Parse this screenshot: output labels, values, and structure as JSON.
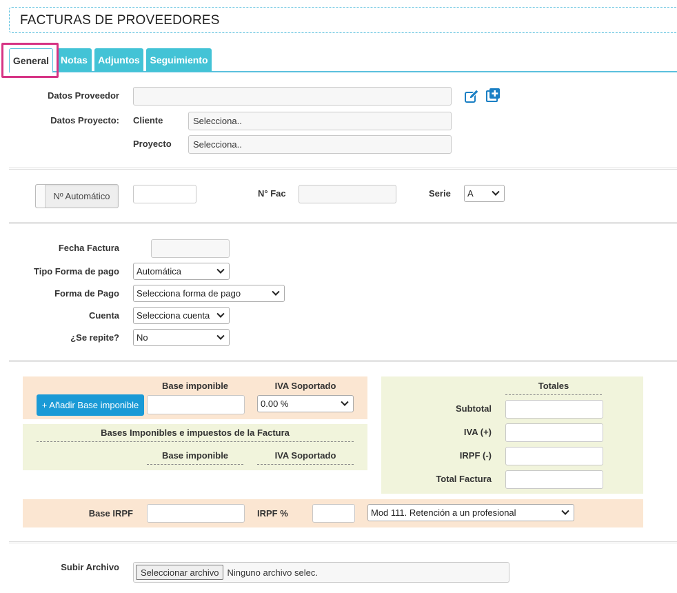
{
  "page": {
    "title": "FACTURAS DE PROVEEDORES"
  },
  "tabs": [
    {
      "label": "General",
      "active": true
    },
    {
      "label": "Notas",
      "active": false
    },
    {
      "label": "Adjuntos",
      "active": false
    },
    {
      "label": "Seguimiento",
      "active": false
    }
  ],
  "proveedor": {
    "label": "Datos Proveedor",
    "value": "",
    "edit_icon": "edit-icon",
    "add_icon": "plus-square-icon"
  },
  "proyecto": {
    "label": "Datos Proyecto:",
    "cliente_label": "Cliente",
    "cliente_value": "Selecciona..",
    "proyecto_label": "Proyecto",
    "proyecto_value": "Selecciona.."
  },
  "numeracion": {
    "toggle_label": "Nº Automático",
    "auto_value": "",
    "nfac_label": "N° Fac",
    "nfac_value": "",
    "serie_label": "Serie",
    "serie_value": "A"
  },
  "pago": {
    "fecha_label": "Fecha Factura",
    "fecha_value": "",
    "tipo_label": "Tipo Forma de pago",
    "tipo_value": "Automática",
    "forma_label": "Forma de Pago",
    "forma_value": "Selecciona forma de pago",
    "cuenta_label": "Cuenta",
    "cuenta_value": "Selecciona cuenta",
    "repite_label": "¿Se repite?",
    "repite_value": "No"
  },
  "bases": {
    "col_base": "Base imponible",
    "col_iva": "IVA Soportado",
    "add_button": "+ Añadir Base imponible",
    "base_value": "",
    "iva_value": "0.00 %",
    "list_title": "Bases Imponibles e impuestos de la Factura",
    "list_col_base": "Base imponible",
    "list_col_iva": "IVA Soportado"
  },
  "totales": {
    "title": "Totales",
    "subtotal_label": "Subtotal",
    "iva_label": "IVA (+)",
    "irpf_label": "IRPF (-)",
    "total_label": "Total Factura",
    "subtotal_value": "",
    "iva_value": "",
    "irpf_value": "",
    "total_value": ""
  },
  "irpf": {
    "base_label": "Base IRPF",
    "base_value": "",
    "pct_label": "IRPF %",
    "pct_value": "",
    "modelo_value": "Mod 111. Retención a un profesional"
  },
  "archivo": {
    "label": "Subir Archivo",
    "button": "Seleccionar archivo",
    "status": "Ninguno archivo selec."
  },
  "colors": {
    "accent": "#5bc0de",
    "tab_bg": "#43c3d6",
    "highlight": "#d63384",
    "primary": "#1a9ad6",
    "peach": "#fbe6d2",
    "green": "#f1f4dc"
  }
}
